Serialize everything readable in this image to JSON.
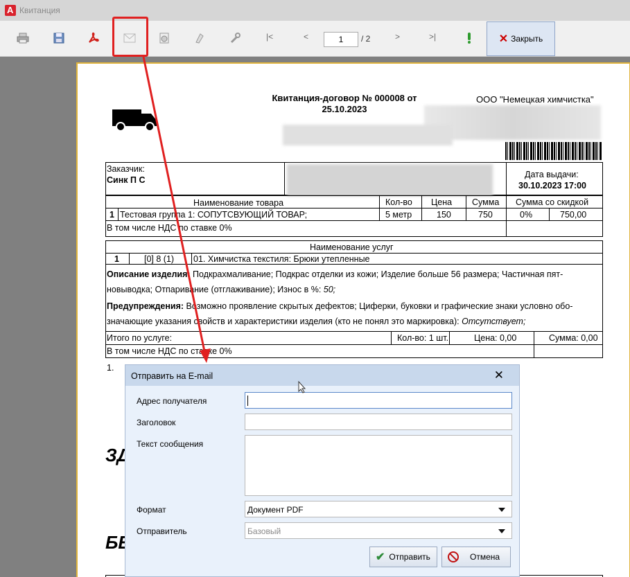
{
  "window": {
    "title": "Квитанция"
  },
  "toolbar": {
    "page_current": "1",
    "page_total": "/ 2",
    "first_label": "|<",
    "prev_label": "<",
    "next_label": ">",
    "last_label": ">|",
    "close_label": "Закрыть"
  },
  "document": {
    "title_line1": "Квитанция-договор № 000008 от",
    "title_line2": "25.10.2023",
    "company": "ООО \"Немецкая химчистка\"",
    "customer_label": "Заказчик:",
    "customer_name": "Синк П С",
    "issue_date_label": "Дата выдачи:",
    "issue_date": "30.10.2023 17:00",
    "goods_headers": [
      "Наименование товара",
      "Кол-во",
      "Цена",
      "Сумма",
      "Сумма со скидкой"
    ],
    "goods_row": {
      "num": "1",
      "name": "Тестовая группа 1: СОПУТСВУЮЩИЙ ТОВАР;",
      "qty": "5 метр",
      "price": "150",
      "sum": "750",
      "discount": "0%",
      "discount_sum": "750,00"
    },
    "goods_vat": "В том числе НДС по ставке 0%",
    "services_header": "Наименование услуг",
    "service_row": {
      "num": "1",
      "code": "[0] 8 (1)",
      "name": "01. Химчистка текстиля: Брюки утепленные"
    },
    "desc_label": "Описание изделия:",
    "desc_text1": "Подкрахмаливание; Подкрас отделки из кожи; Изделие больше 56 размера; Частичная пят-",
    "desc_text2": "новыводка; Отпаривание (отглаживание); Износ в %:",
    "desc_wear": "50;",
    "warn_label": "Предупреждения:",
    "warn_text1": "Возможно проявление скрытых дефектов; Циферки, буковки и графические знаки условно обо-",
    "warn_text2": "значающие указания свойств и характеристики изделия (кто не понял это маркировка):",
    "warn_absent": "Отсутствует;",
    "total_label": "Итого по услуге:",
    "total_qty": "Кол-во: 1 шт.",
    "total_price": "Цена: 0,00",
    "total_sum": "Сумма: 0,00",
    "services_vat": "В том числе НДС по ставке 0%",
    "list_num": "1.",
    "big_text1": "ЗД",
    "big_text2": "БЕ"
  },
  "dialog": {
    "title": "Отправить на E-mail",
    "recipient_label": "Адрес получателя",
    "recipient_value": "",
    "subject_label": "Заголовок",
    "subject_value": "",
    "message_label": "Текст сообщения",
    "message_value": "",
    "format_label": "Формат",
    "format_value": "Документ PDF",
    "sender_label": "Отправитель",
    "sender_value": "Базовый",
    "send_label": "Отправить",
    "cancel_label": "Отмена"
  },
  "colors": {
    "accent_red": "#e02020",
    "barcode": "#000000"
  }
}
